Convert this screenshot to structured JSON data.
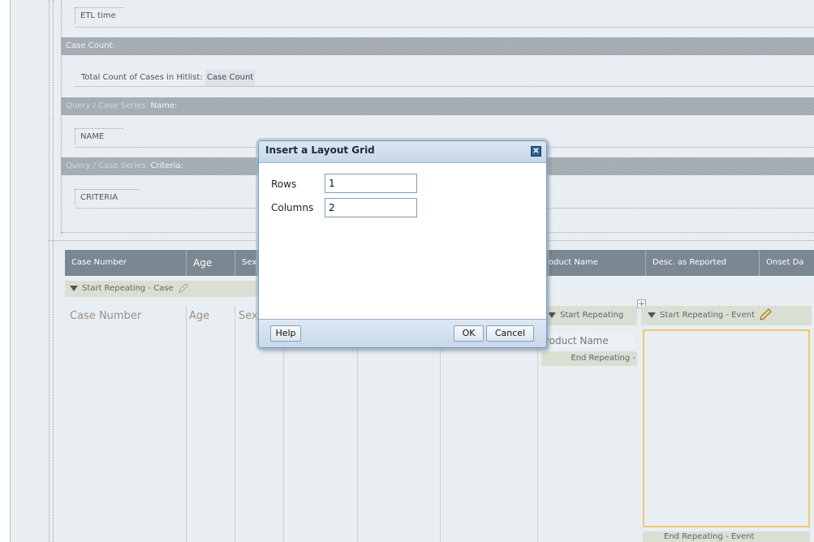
{
  "fields": {
    "etl_time": "ETL time",
    "case_count_header": "Case Count:",
    "total_count_label": "Total Count of Cases in Hitlist:",
    "case_count_chip": "Case Count",
    "query_pill": "Query / Case Series",
    "name_label": "Name:",
    "name_field": "NAME",
    "criteria_label": "Criteria:",
    "criteria_field": "CRITERIA"
  },
  "table": {
    "headers": [
      "Case Number",
      "Age",
      "Sex",
      "oduct Name",
      "Desc. as Reported",
      "Onset Da"
    ],
    "start_repeating_case": "Start Repeating - Case",
    "body": [
      "Case Number",
      "Age",
      "Sex"
    ],
    "start_repeating_product": "Start Repeating",
    "product_name": "roduct Name",
    "end_repeating_product": "End Repeating -",
    "start_repeating_event": "Start Repeating - Event",
    "end_repeating_event": "End Repeating - Event"
  },
  "dialog": {
    "title": "Insert a Layout Grid",
    "close_glyph": "✕",
    "rows_label": "Rows",
    "rows_value": "1",
    "columns_label": "Columns",
    "columns_value": "2",
    "help_button": "Help",
    "ok_button": "OK",
    "cancel_button": "Cancel"
  },
  "icons": {
    "collapse": "triangle-down-icon",
    "edit": "pencil-icon",
    "move": "move-handle-icon",
    "close": "close-icon"
  },
  "colors": {
    "band": "#a3acb2",
    "header": "#7b8791",
    "accent_outline": "#f0c872",
    "dialog_border": "#7a98b8"
  }
}
